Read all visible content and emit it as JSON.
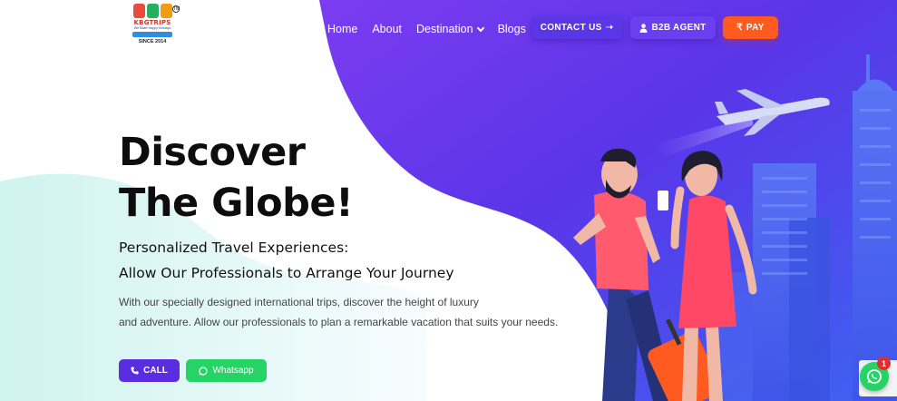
{
  "brand": {
    "name": "KBGTRIPS",
    "tagline": "We Make Happy Holidays",
    "since": "SINCE 2014",
    "tm": "TM"
  },
  "nav": {
    "items": [
      {
        "label": "Home"
      },
      {
        "label": "About"
      },
      {
        "label": "Destination",
        "has_dropdown": true
      },
      {
        "label": "Blogs"
      }
    ]
  },
  "header_buttons": {
    "contact": {
      "label": "CONTACT US",
      "icon": "arrow-right-icon"
    },
    "b2b": {
      "label": "B2B AGENT",
      "icon": "user-icon"
    },
    "pay": {
      "label": "PAY",
      "icon": "rupee-icon",
      "prefix": "₹"
    }
  },
  "hero": {
    "title_line1": "Discover",
    "title_line2": "The Globe!",
    "subtitle_line1": "Personalized Travel Experiences:",
    "subtitle_line2": "Allow Our Professionals to Arrange Your Journey",
    "description_line1": "With our specially designed international trips, discover the height of luxury",
    "description_line2": "and adventure. Allow our professionals to plan a remarkable vacation that suits your needs."
  },
  "cta": {
    "call": {
      "label": "CALL",
      "icon": "phone-icon"
    },
    "whatsapp": {
      "label": "Whatsapp",
      "icon": "whatsapp-icon"
    }
  },
  "floating": {
    "whatsapp_badge": "1"
  },
  "colors": {
    "purple_dark": "#5a1fe0",
    "purple_light": "#7b3cf2",
    "blue_accent": "#4a6cf7",
    "orange": "#ff5a1f",
    "green": "#25d366",
    "mint": "#c9f2ec"
  }
}
